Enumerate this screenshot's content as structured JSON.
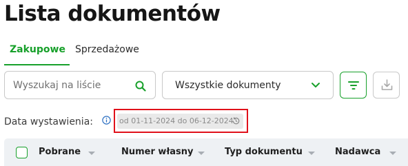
{
  "page": {
    "title": "Lista dokumentów"
  },
  "tabs": [
    {
      "label": "Zakupowe",
      "active": true
    },
    {
      "label": "Sprzedażowe",
      "active": false
    }
  ],
  "search": {
    "placeholder": "Wyszukaj na liście",
    "icon": "search-icon"
  },
  "doc_filter": {
    "selected": "Wszystkie dokumenty",
    "icon": "chevron-down-icon"
  },
  "toolbar": {
    "filter_icon": "filter-icon",
    "download_icon": "download-icon"
  },
  "date_filter": {
    "label": "Data wystawienia:",
    "range": "od 01-11-2024 do 06-12-2024",
    "info_icon": "info-icon",
    "reset_icon": "reset-icon"
  },
  "table": {
    "columns": [
      "Pobrane",
      "Numer własny",
      "Typ dokumentu",
      "Nadawca"
    ]
  },
  "colors": {
    "accent": "#17a02a",
    "highlight": "#e0101a",
    "header_bg": "#eef1f4"
  }
}
